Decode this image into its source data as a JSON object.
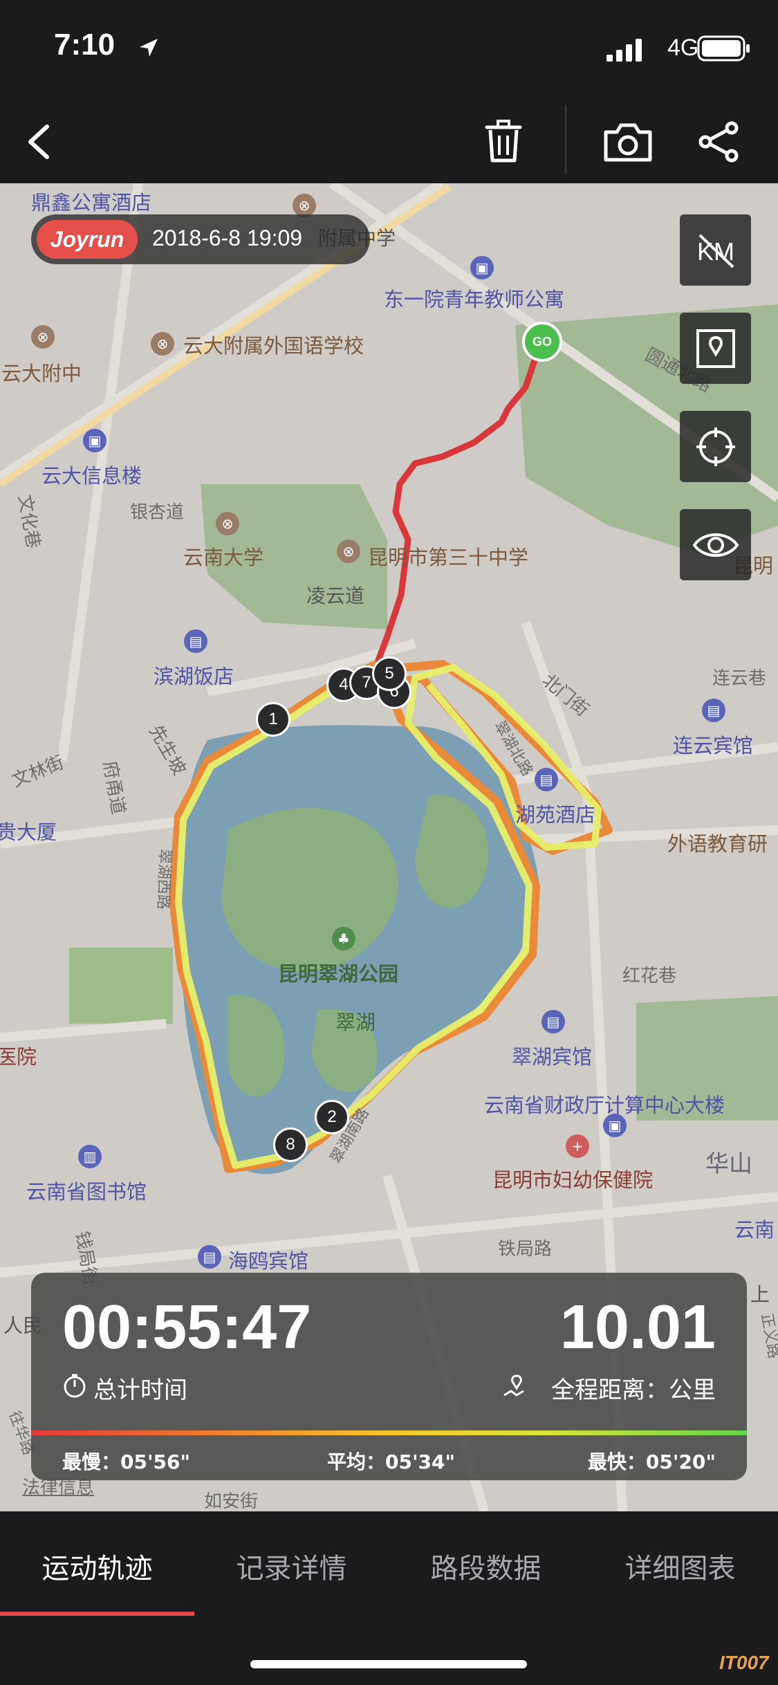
{
  "status": {
    "time": "7:10",
    "network": "4G"
  },
  "toolbar": {
    "icons": [
      "back-icon",
      "trash-icon",
      "camera-icon",
      "share-icon"
    ]
  },
  "badge": {
    "brand": "Joyrun",
    "datetime": "2018-6-8 19:09"
  },
  "map": {
    "labels": {
      "l1": "鼎鑫公寓酒店",
      "l2": "附属中学",
      "l3": "东一院青年教师公寓",
      "l4": "云大附属外国语学校",
      "l5": "云大附中",
      "l6": "圆通北路",
      "l7": "云大信息楼",
      "l8": "银杏道",
      "l9": "文化巷",
      "l10": "云南大学",
      "l11": "昆明市第三十中学",
      "l12": "昆明",
      "l13": "凌云道",
      "l14": "滨湖饭店",
      "l15": "北门街",
      "l16": "连云巷",
      "l17": "连云宾馆",
      "l18": "先生坡",
      "l19": "文林街",
      "l20": "府甬道",
      "l21": "贵大厦",
      "l22": "翠湖西路",
      "l23": "翠湖北路",
      "l24": "湖苑酒店",
      "l25": "外语教育研",
      "l26": "昆明翠湖公园",
      "l27": "红花巷",
      "l28": "翠湖",
      "l29": "翠湖宾馆",
      "l30": "医院",
      "l31": "云南省财政厅计算中心大楼",
      "l32": "云南省图书馆",
      "l33": "昆明市妇幼保健院",
      "l34": "华山",
      "l35": "云南",
      "l36": "海鸥宾馆",
      "l37": "铁局路",
      "l38": "钱局街",
      "l39": "翠湖南路",
      "l40": "法律信息",
      "l41": "如安街",
      "l42": "上",
      "l43": "正义路",
      "l44": "人民",
      "l45": "往华路"
    },
    "start_marker": "GO",
    "km_markers": [
      "1",
      "2",
      "4",
      "7",
      "6",
      "8",
      "5"
    ]
  },
  "stats": {
    "duration": "00:55:47",
    "duration_label": "总计时间",
    "distance": "10.01",
    "distance_label": "全程距离：公里",
    "slowest": "最慢：05'56\"",
    "average": "平均：05'34\"",
    "fastest": "最快：05'20\""
  },
  "tabs": [
    "运动轨迹",
    "记录详情",
    "路段数据",
    "详细图表"
  ],
  "watermark": "IT007",
  "colors": {
    "accent": "#e34a4a",
    "route_red": "#d9373a",
    "route_yellow": "#e7ef6a",
    "route_orange": "#e9893a",
    "lake": "#7c9fb3",
    "park": "#8fb07a"
  }
}
